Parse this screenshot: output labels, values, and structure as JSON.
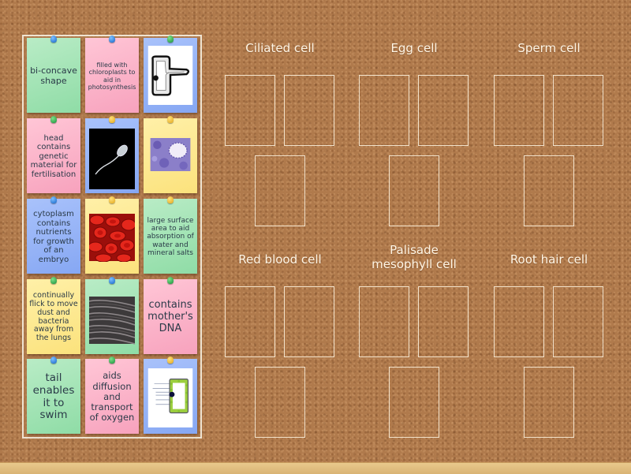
{
  "cards": [
    {
      "type": "text",
      "text": "bi-concave shape",
      "color": "green",
      "pin": "blue"
    },
    {
      "type": "text",
      "text": "filled with chloroplasts to aid in photosynthesis",
      "color": "pink",
      "pin": "blue"
    },
    {
      "type": "image",
      "image": "root-hair-cell-diagram",
      "color": "blue",
      "pin": "green"
    },
    {
      "type": "text",
      "text": "head contains genetic material for fertilisation",
      "color": "pink",
      "pin": "green"
    },
    {
      "type": "image",
      "image": "sperm-cell-photo",
      "color": "blue",
      "pin": "yellow"
    },
    {
      "type": "image",
      "image": "egg-cell-micrograph",
      "color": "yellow",
      "pin": "yellow"
    },
    {
      "type": "text",
      "text": "cytoplasm contains nutrients for growth of an embryo",
      "color": "blue",
      "pin": "blue"
    },
    {
      "type": "image",
      "image": "red-blood-cells-photo",
      "color": "yellow",
      "pin": "yellow"
    },
    {
      "type": "text",
      "text": "large surface area to aid absorption of water and mineral salts",
      "color": "green",
      "pin": "yellow"
    },
    {
      "type": "text",
      "text": "continually flick to move dust and bacteria away from the lungs",
      "color": "yellow",
      "pin": "green"
    },
    {
      "type": "image",
      "image": "cilia-micrograph",
      "color": "green",
      "pin": "blue"
    },
    {
      "type": "text",
      "text": "contains mother's DNA",
      "color": "pink",
      "pin": "green"
    },
    {
      "type": "text",
      "text": "tail enables it to swim",
      "color": "green",
      "pin": "blue"
    },
    {
      "type": "text",
      "text": "aids diffusion and transport of oxygen",
      "color": "pink",
      "pin": "green"
    },
    {
      "type": "image",
      "image": "palisade-cell-diagram",
      "color": "blue",
      "pin": "yellow"
    }
  ],
  "groups": [
    {
      "title": "Ciliated cell"
    },
    {
      "title": "Egg cell"
    },
    {
      "title": "Sperm cell"
    },
    {
      "title": "Red blood cell"
    },
    {
      "title": "Palisade mesophyll cell"
    },
    {
      "title": "Root hair cell"
    }
  ]
}
